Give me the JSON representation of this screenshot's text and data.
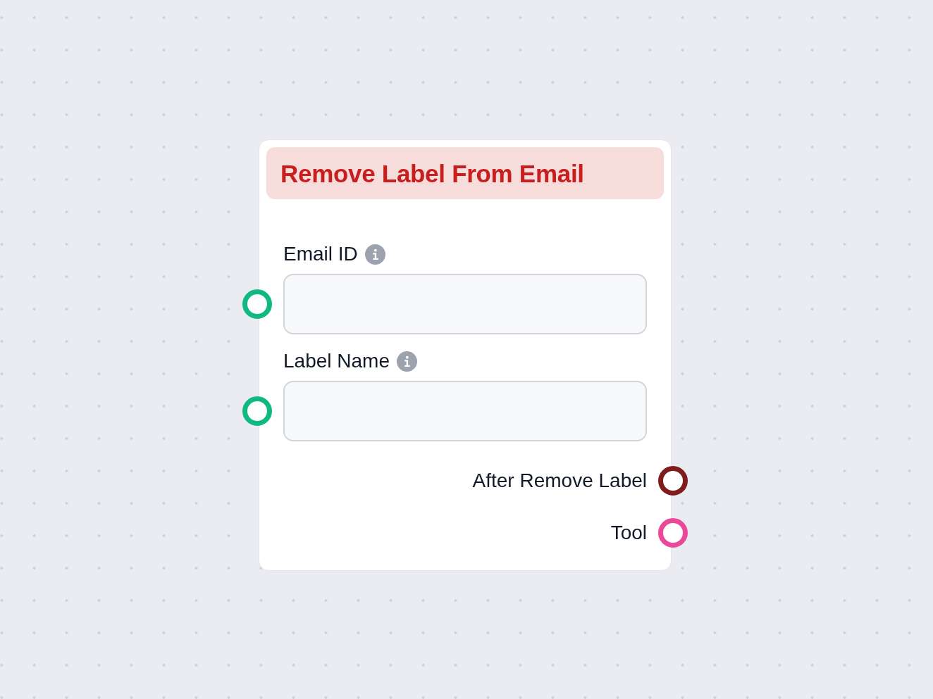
{
  "node": {
    "title": "Remove Label From Email",
    "inputs": [
      {
        "label": "Email ID"
      },
      {
        "label": "Label Name"
      }
    ],
    "outputs": [
      {
        "label": "After Remove Label",
        "color": "#7f1d1d"
      },
      {
        "label": "Tool",
        "color": "#ec4899"
      }
    ]
  }
}
